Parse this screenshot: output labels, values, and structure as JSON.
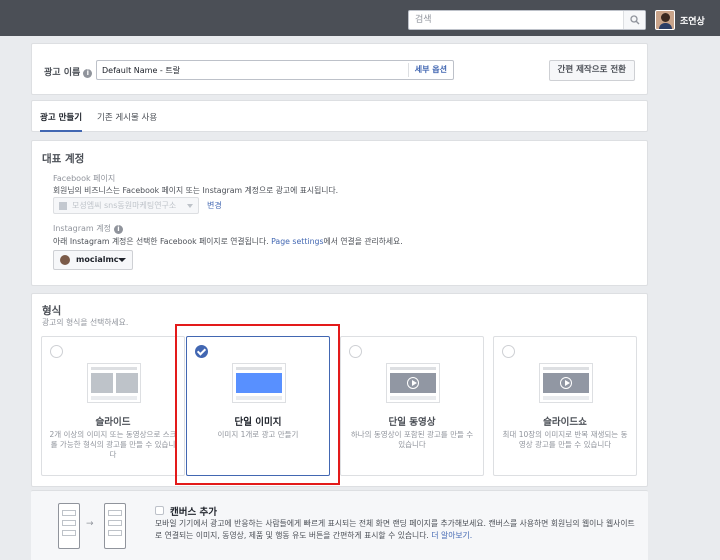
{
  "header": {
    "search_placeholder": "검색",
    "user_name": "조연상"
  },
  "ad_name": {
    "label": "광고 이름",
    "value": "Default Name - 트랄",
    "details_link": "세부 옵션",
    "switch_button": "간편 제작으로 전환"
  },
  "tabs": [
    {
      "label": "광고 만들기",
      "active": true
    },
    {
      "label": "기존 게시물 사용",
      "active": false
    }
  ],
  "identity": {
    "title": "대표 계정",
    "facebook_label": "Facebook 페이지",
    "facebook_desc": "회원님의 비즈니스는 Facebook 페이지 또는 Instagram 계정으로 광고에 표시됩니다.",
    "page_value": "모셩엠씨 sns동원마케팅연구소",
    "change_link": "변경",
    "instagram_label": "Instagram 계정",
    "instagram_desc_prefix": "아래 Instagram 계정은 선택한 Facebook 페이지로 연결됩니다.",
    "instagram_desc_link": "Page settings",
    "instagram_desc_suffix": "에서 연결을 관리하세요.",
    "instagram_value": "mocialmc"
  },
  "format": {
    "title": "형식",
    "subtitle": "광고의 형식을 선택하세요.",
    "options": [
      {
        "title": "슬라이드",
        "desc": "2개 이상의 이미지 또는 동영상으로 스크롤 가능한 형식의 광고를 만들 수 있습니다",
        "selected": false,
        "icon": "carousel-thumbnail"
      },
      {
        "title": "단일 이미지",
        "desc": "이미지 1개로 광고 만들기",
        "selected": true,
        "icon": "single-image-thumbnail"
      },
      {
        "title": "단일 동영상",
        "desc": "하나의 동영상이 포함된 광고를 만들 수 있습니다",
        "selected": false,
        "icon": "video-thumbnail"
      },
      {
        "title": "슬라이드쇼",
        "desc": "최대 10장의 이미지로 반복 재생되는 동영상 광고를 만들 수 있습니다",
        "selected": false,
        "icon": "slideshow-thumbnail"
      }
    ]
  },
  "canvas": {
    "title": "캔버스 추가",
    "desc": "모바일 기기에서 광고에 반응하는 사람들에게 빠르게 표시되는 전체 화면 랜딩 페이지를 추가해보세요. 캔버스를 사용하면 회원님의 웹이나 웹사이트로 연결되는 이미지, 동영상, 제품 및 행동 유도 버튼을 간편하게 표시할 수 있습니다.",
    "more_link": "더 알아보기."
  },
  "colors": {
    "topbar": "#4b4f56",
    "accent": "#4267b2",
    "highlight": "#e31a1a"
  }
}
